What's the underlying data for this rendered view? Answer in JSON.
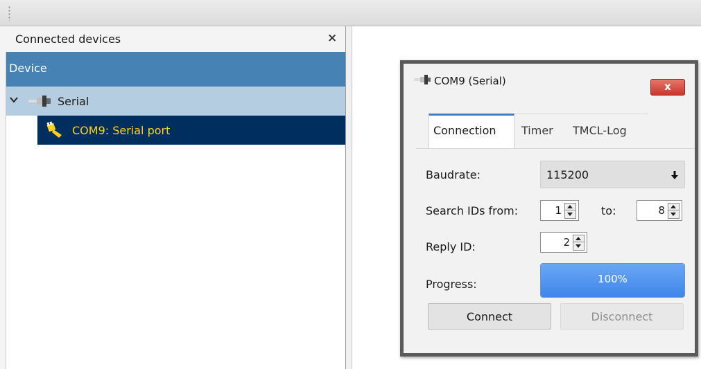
{
  "dock": {
    "title": "Connected devices",
    "close_glyph": "×",
    "tree": {
      "column_header": "Device",
      "group": {
        "label": "Serial",
        "icon": "serial-connector-icon",
        "expanded": true
      },
      "device": {
        "label": "COM9: Serial port",
        "icon": "serial-port-plug-icon",
        "selected": true
      }
    }
  },
  "dialog": {
    "title": "COM9 (Serial)",
    "close_glyph": "x",
    "tabs": [
      {
        "label": "Connection",
        "active": true
      },
      {
        "label": "Timer",
        "active": false
      },
      {
        "label": "TMCL-Log",
        "active": false
      }
    ],
    "form": {
      "baudrate_label": "Baudrate:",
      "baudrate_value": "115200",
      "search_from_label": "Search IDs from:",
      "search_from_value": "1",
      "search_to_label": "to:",
      "search_to_value": "8",
      "reply_id_label": "Reply ID:",
      "reply_id_value": "2",
      "progress_label": "Progress:",
      "progress_text": "100%",
      "progress_value": 1.0
    },
    "buttons": {
      "connect": "Connect",
      "disconnect": "Disconnect",
      "disconnect_enabled": false
    }
  },
  "colors": {
    "tree_header_bg": "#4682b4",
    "selected_row_bg": "#002f5f",
    "selected_row_text": "#ffd11a",
    "group_row_bg": "#b5cde0",
    "active_tab_accent": "#3b7fd4",
    "progress_fill": "#3f86ea"
  }
}
